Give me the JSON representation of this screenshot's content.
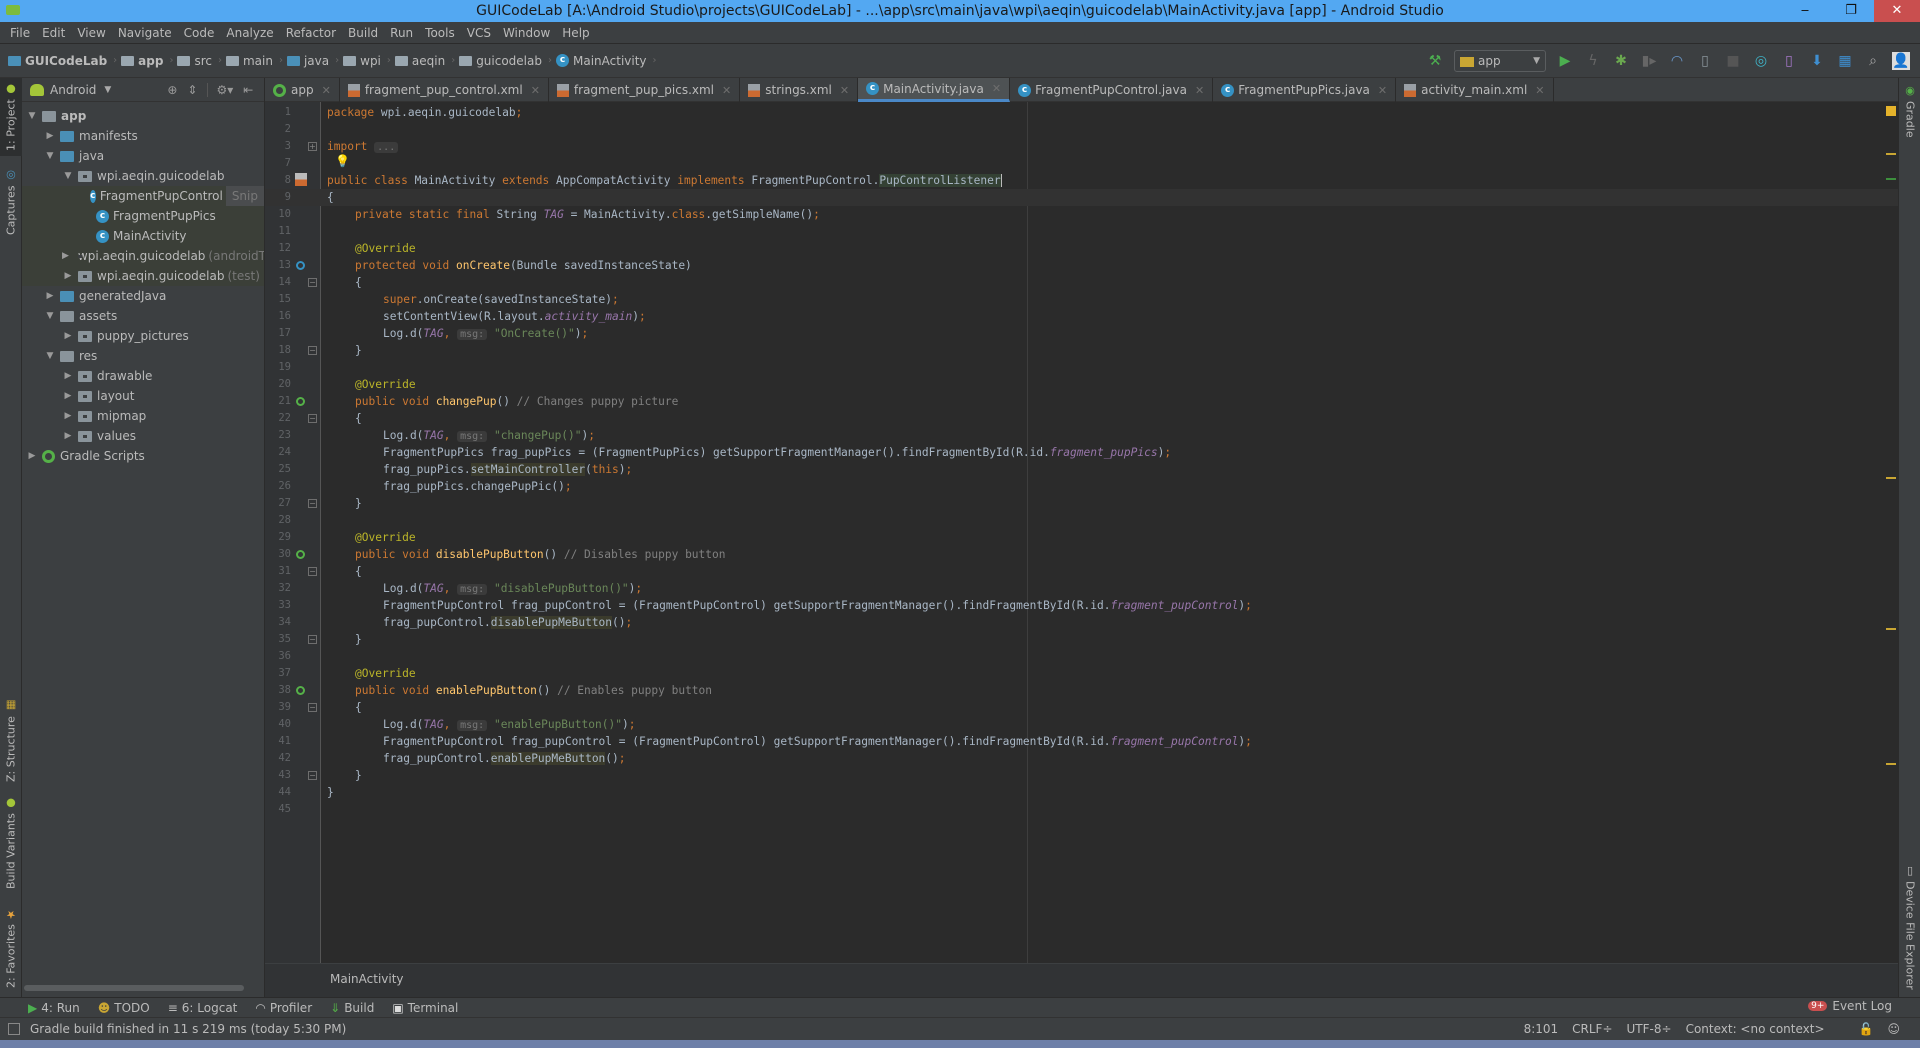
{
  "window": {
    "title": "GUICodeLab [A:\\Android Studio\\projects\\GUICodeLab] - ...\\app\\src\\main\\java\\wpi\\aeqin\\guicodelab\\MainActivity.java [app] - Android Studio",
    "minimize": "‒",
    "restore": "❐",
    "close": "✕"
  },
  "menu": [
    "File",
    "Edit",
    "View",
    "Navigate",
    "Code",
    "Analyze",
    "Refactor",
    "Build",
    "Run",
    "Tools",
    "VCS",
    "Window",
    "Help"
  ],
  "breadcrumb": [
    {
      "label": "GUICodeLab",
      "icon": "project-folder-icon",
      "bold": true
    },
    {
      "label": "app",
      "icon": "module-folder-icon",
      "bold": true
    },
    {
      "label": "src",
      "icon": "folder-icon"
    },
    {
      "label": "main",
      "icon": "folder-icon"
    },
    {
      "label": "java",
      "icon": "source-folder-icon"
    },
    {
      "label": "wpi",
      "icon": "package-icon"
    },
    {
      "label": "aeqin",
      "icon": "package-icon"
    },
    {
      "label": "guicodelab",
      "icon": "package-icon"
    },
    {
      "label": "MainActivity",
      "icon": "class-icon"
    }
  ],
  "toolbar": {
    "run_config": "app",
    "buttons": [
      "make-project",
      "run",
      "apply-changes",
      "debug",
      "attach-debugger",
      "profile",
      "install",
      "stop",
      "sync-gradle",
      "avd-manager",
      "sdk-manager",
      "project-structure",
      "search",
      "user"
    ]
  },
  "left_strip": {
    "project": "1: Project",
    "captures": "Captures",
    "structure": "Z: Structure",
    "build_variants": "Build Variants",
    "favorites": "2: Favorites"
  },
  "right_strip": {
    "gradle": "Gradle",
    "device_file_explorer": "Device File Explorer"
  },
  "project_panel": {
    "view_mode": "Android",
    "tree": [
      {
        "label": "app",
        "depth": 0,
        "expanded": true,
        "type": "module",
        "bold": true
      },
      {
        "label": "manifests",
        "depth": 1,
        "expanded": false,
        "type": "folder"
      },
      {
        "label": "java",
        "depth": 1,
        "expanded": true,
        "type": "folder"
      },
      {
        "label": "wpi.aeqin.guicodelab",
        "depth": 2,
        "expanded": true,
        "type": "package"
      },
      {
        "label": "FragmentPupControl",
        "depth": 3,
        "type": "class",
        "overlay": "Snip"
      },
      {
        "label": "FragmentPupPics",
        "depth": 3,
        "type": "class"
      },
      {
        "label": "MainActivity",
        "depth": 3,
        "type": "class",
        "selected": true
      },
      {
        "label": "wpi.aeqin.guicodelab",
        "suffix": "(androidT",
        "depth": 2,
        "expanded": false,
        "type": "package"
      },
      {
        "label": "wpi.aeqin.guicodelab",
        "suffix": "(test)",
        "depth": 2,
        "expanded": false,
        "type": "package"
      },
      {
        "label": "generatedJava",
        "depth": 1,
        "expanded": false,
        "type": "folder"
      },
      {
        "label": "assets",
        "depth": 1,
        "expanded": true,
        "type": "folder"
      },
      {
        "label": "puppy_pictures",
        "depth": 2,
        "expanded": false,
        "type": "package"
      },
      {
        "label": "res",
        "depth": 1,
        "expanded": true,
        "type": "folder"
      },
      {
        "label": "drawable",
        "depth": 2,
        "expanded": false,
        "type": "package"
      },
      {
        "label": "layout",
        "depth": 2,
        "expanded": false,
        "type": "package"
      },
      {
        "label": "mipmap",
        "depth": 2,
        "expanded": false,
        "type": "package"
      },
      {
        "label": "values",
        "depth": 2,
        "expanded": false,
        "type": "package"
      },
      {
        "label": "Gradle Scripts",
        "depth": 0,
        "expanded": false,
        "type": "gradle"
      }
    ]
  },
  "tabs": [
    {
      "label": "app",
      "icon": "app-icon"
    },
    {
      "label": "fragment_pup_control.xml",
      "icon": "xml-icon"
    },
    {
      "label": "fragment_pup_pics.xml",
      "icon": "xml-icon"
    },
    {
      "label": "strings.xml",
      "icon": "xml-icon"
    },
    {
      "label": "MainActivity.java",
      "icon": "class-icon",
      "active": true
    },
    {
      "label": "FragmentPupControl.java",
      "icon": "class-icon"
    },
    {
      "label": "FragmentPupPics.java",
      "icon": "class-icon"
    },
    {
      "label": "activity_main.xml",
      "icon": "xml-icon"
    }
  ],
  "editor": {
    "lines": [
      {
        "n": "1",
        "ind": 0,
        "t": [
          [
            "kw",
            "package "
          ],
          [
            "",
            "wpi.aeqin.guicodelab"
          ],
          [
            "kw",
            ";"
          ]
        ]
      },
      {
        "n": "2",
        "ind": 0,
        "t": []
      },
      {
        "n": "3",
        "ind": 0,
        "t": [
          [
            "kw",
            "import "
          ],
          [
            "hint",
            "..."
          ]
        ]
      },
      {
        "n": "7",
        "ind": 0,
        "t": []
      },
      {
        "n": "8",
        "ind": 0,
        "t": [
          [
            "kw",
            "public class "
          ],
          [
            "",
            "MainActivity "
          ],
          [
            "kw",
            "extends "
          ],
          [
            "",
            "AppCompatActivity "
          ],
          [
            "kw",
            "implements "
          ],
          [
            "",
            "FragmentPupControl."
          ],
          [
            "cls",
            "PupControlListener"
          ]
        ]
      },
      {
        "n": "9",
        "ind": 0,
        "cur": true,
        "t": [
          [
            "",
            "{"
          ]
        ]
      },
      {
        "n": "10",
        "ind": 1,
        "t": [
          [
            "kw",
            "private static final "
          ],
          [
            "",
            "String "
          ],
          [
            "sf",
            "TAG"
          ],
          [
            "",
            " = MainActivity."
          ],
          [
            "kw",
            "class"
          ],
          [
            "",
            ".getSimpleName()"
          ],
          [
            "kw",
            ";"
          ]
        ]
      },
      {
        "n": "11",
        "ind": 0,
        "t": []
      },
      {
        "n": "12",
        "ind": 1,
        "t": [
          [
            "an",
            "@Override"
          ]
        ]
      },
      {
        "n": "13",
        "ind": 1,
        "t": [
          [
            "kw",
            "protected void "
          ],
          [
            "fn",
            "onCreate"
          ],
          [
            "",
            "(Bundle savedInstanceState)"
          ]
        ]
      },
      {
        "n": "14",
        "ind": 1,
        "t": [
          [
            "",
            "{"
          ]
        ]
      },
      {
        "n": "15",
        "ind": 2,
        "t": [
          [
            "kw",
            "super"
          ],
          [
            "",
            ".onCreate(savedInstanceState)"
          ],
          [
            "kw",
            ";"
          ]
        ]
      },
      {
        "n": "16",
        "ind": 2,
        "t": [
          [
            "",
            "setContentView(R.layout."
          ],
          [
            "it",
            "activity_main"
          ],
          [
            "",
            ")"
          ],
          [
            "kw",
            ";"
          ]
        ]
      },
      {
        "n": "17",
        "ind": 2,
        "t": [
          [
            "",
            "Log.d("
          ],
          [
            "sf",
            "TAG"
          ],
          [
            "kw",
            ", "
          ],
          [
            "hint",
            "msg:"
          ],
          [
            "st",
            " \"OnCreate()\""
          ],
          [
            "",
            ")"
          ],
          [
            "kw",
            ";"
          ]
        ]
      },
      {
        "n": "18",
        "ind": 1,
        "t": [
          [
            "",
            "}"
          ]
        ]
      },
      {
        "n": "19",
        "ind": 0,
        "t": []
      },
      {
        "n": "20",
        "ind": 1,
        "t": [
          [
            "an",
            "@Override"
          ]
        ]
      },
      {
        "n": "21",
        "ind": 1,
        "t": [
          [
            "kw",
            "public void "
          ],
          [
            "fn",
            "changePup"
          ],
          [
            "",
            "() "
          ],
          [
            "cm",
            "// Changes puppy picture"
          ]
        ]
      },
      {
        "n": "22",
        "ind": 1,
        "t": [
          [
            "",
            "{"
          ]
        ]
      },
      {
        "n": "23",
        "ind": 2,
        "t": [
          [
            "",
            "Log.d("
          ],
          [
            "sf",
            "TAG"
          ],
          [
            "kw",
            ", "
          ],
          [
            "hint",
            "msg:"
          ],
          [
            "st",
            " \"changePup()\""
          ],
          [
            "",
            ")"
          ],
          [
            "kw",
            ";"
          ]
        ]
      },
      {
        "n": "24",
        "ind": 2,
        "t": [
          [
            "",
            "FragmentPupPics frag_pupPics = (FragmentPupPics) getSupportFragmentManager().findFragmentById(R.id."
          ],
          [
            "it",
            "fragment_pupPics"
          ],
          [
            "",
            ")"
          ],
          [
            "kw",
            ";"
          ]
        ]
      },
      {
        "n": "25",
        "ind": 2,
        "t": [
          [
            "",
            "frag_pupPics."
          ],
          [
            "mh",
            "setMainController"
          ],
          [
            "",
            "("
          ],
          [
            "kw",
            "this"
          ],
          [
            "",
            ")"
          ],
          [
            "kw",
            ";"
          ]
        ]
      },
      {
        "n": "26",
        "ind": 2,
        "t": [
          [
            "",
            "frag_pupPics.changePupPic()"
          ],
          [
            "kw",
            ";"
          ]
        ]
      },
      {
        "n": "27",
        "ind": 1,
        "t": [
          [
            "",
            "}"
          ]
        ]
      },
      {
        "n": "28",
        "ind": 0,
        "t": []
      },
      {
        "n": "29",
        "ind": 1,
        "t": [
          [
            "an",
            "@Override"
          ]
        ]
      },
      {
        "n": "30",
        "ind": 1,
        "t": [
          [
            "kw",
            "public void "
          ],
          [
            "fn",
            "disablePupButton"
          ],
          [
            "",
            "() "
          ],
          [
            "cm",
            "// Disables puppy button"
          ]
        ]
      },
      {
        "n": "31",
        "ind": 1,
        "t": [
          [
            "",
            "{"
          ]
        ]
      },
      {
        "n": "32",
        "ind": 2,
        "t": [
          [
            "",
            "Log.d("
          ],
          [
            "sf",
            "TAG"
          ],
          [
            "kw",
            ", "
          ],
          [
            "hint",
            "msg:"
          ],
          [
            "st",
            " \"disablePupButton()\""
          ],
          [
            "",
            ")"
          ],
          [
            "kw",
            ";"
          ]
        ]
      },
      {
        "n": "33",
        "ind": 2,
        "t": [
          [
            "",
            "FragmentPupControl frag_pupControl = (FragmentPupControl) getSupportFragmentManager().findFragmentById(R.id."
          ],
          [
            "it",
            "fragment_pupControl"
          ],
          [
            "",
            ")"
          ],
          [
            "kw",
            ";"
          ]
        ]
      },
      {
        "n": "34",
        "ind": 2,
        "t": [
          [
            "",
            "frag_pupControl."
          ],
          [
            "mh",
            "disablePupMeButton"
          ],
          [
            "",
            "()"
          ],
          [
            "kw",
            ";"
          ]
        ]
      },
      {
        "n": "35",
        "ind": 1,
        "t": [
          [
            "",
            "}"
          ]
        ]
      },
      {
        "n": "36",
        "ind": 0,
        "t": []
      },
      {
        "n": "37",
        "ind": 1,
        "t": [
          [
            "an",
            "@Override"
          ]
        ]
      },
      {
        "n": "38",
        "ind": 1,
        "t": [
          [
            "kw",
            "public void "
          ],
          [
            "fn",
            "enablePupButton"
          ],
          [
            "",
            "() "
          ],
          [
            "cm",
            "// Enables puppy button"
          ]
        ]
      },
      {
        "n": "39",
        "ind": 1,
        "t": [
          [
            "",
            "{"
          ]
        ]
      },
      {
        "n": "40",
        "ind": 2,
        "t": [
          [
            "",
            "Log.d("
          ],
          [
            "sf",
            "TAG"
          ],
          [
            "kw",
            ", "
          ],
          [
            "hint",
            "msg:"
          ],
          [
            "st",
            " \"enablePupButton()\""
          ],
          [
            "",
            ")"
          ],
          [
            "kw",
            ";"
          ]
        ]
      },
      {
        "n": "41",
        "ind": 2,
        "t": [
          [
            "",
            "FragmentPupControl frag_pupControl = (FragmentPupControl) getSupportFragmentManager().findFragmentById(R.id."
          ],
          [
            "it",
            "fragment_pupControl"
          ],
          [
            "",
            ")"
          ],
          [
            "kw",
            ";"
          ]
        ]
      },
      {
        "n": "42",
        "ind": 2,
        "t": [
          [
            "",
            "frag_pupControl."
          ],
          [
            "mh",
            "enablePupMeButton"
          ],
          [
            "",
            "()"
          ],
          [
            "kw",
            ";"
          ]
        ]
      },
      {
        "n": "43",
        "ind": 1,
        "t": [
          [
            "",
            "}"
          ]
        ]
      },
      {
        "n": "44",
        "ind": 0,
        "t": [
          [
            "",
            "}"
          ]
        ]
      },
      {
        "n": "45",
        "ind": 0,
        "t": []
      }
    ],
    "breadcrumb": "MainActivity"
  },
  "tool_windows": [
    {
      "label": "4: Run",
      "icon": "run-icon"
    },
    {
      "label": "TODO",
      "icon": "todo-icon"
    },
    {
      "label": "6: Logcat",
      "icon": "logcat-icon"
    },
    {
      "label": "Profiler",
      "icon": "profiler-icon"
    },
    {
      "label": "Build",
      "icon": "build-icon"
    },
    {
      "label": "Terminal",
      "icon": "terminal-icon"
    }
  ],
  "event_log": {
    "label": "Event Log",
    "badge": "9+"
  },
  "status": {
    "message": "Gradle build finished in 11 s 219 ms (today 5:30 PM)",
    "position": "8:101",
    "line_separator": "CRLF÷",
    "encoding": "UTF-8÷",
    "context": "Context: <no context>"
  },
  "colors": {
    "accent": "#4a88c7",
    "titlebar": "#53a8f2",
    "selection": "#0d293e"
  }
}
